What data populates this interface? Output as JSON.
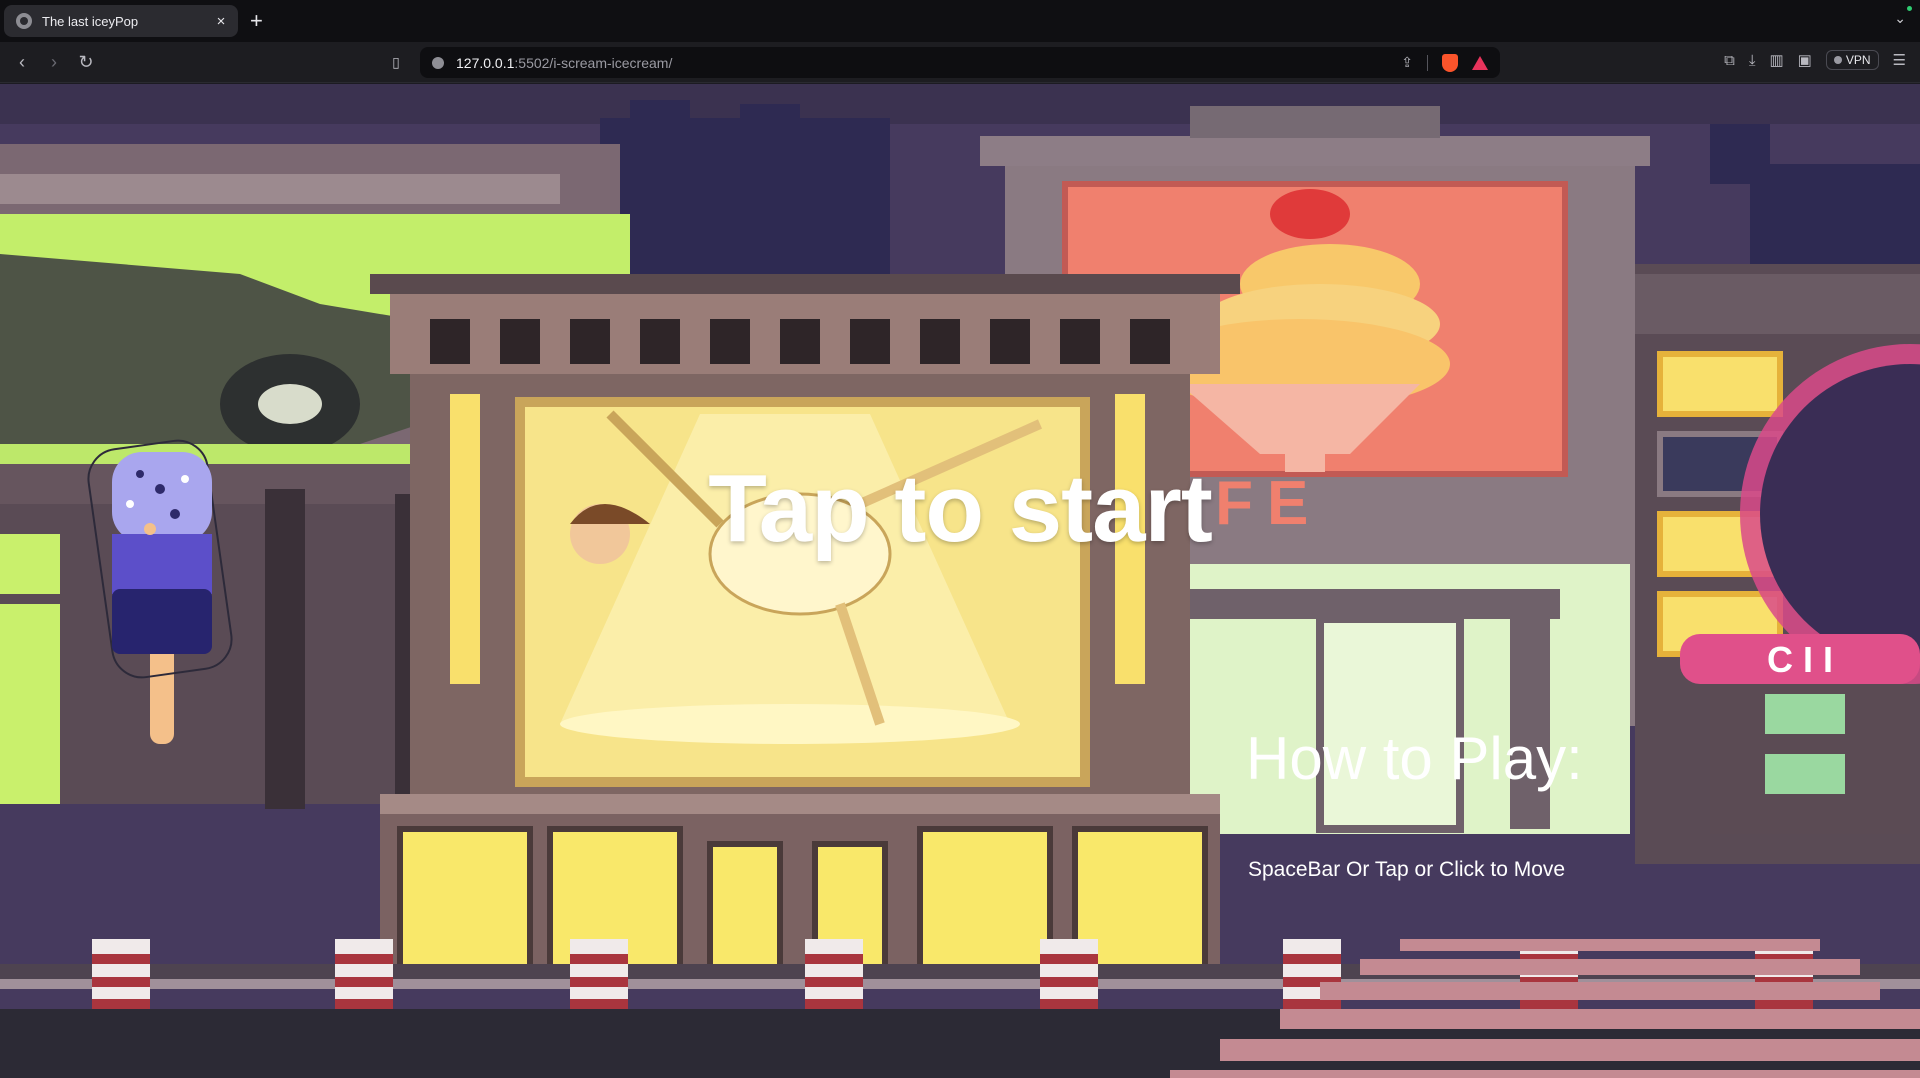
{
  "browser": {
    "tab_title": "The last iceyPop",
    "tab_close": "×",
    "new_tab": "+",
    "url_host": "127.0.0.1",
    "url_path": ":5502/i-scream-icecream/",
    "vpn_label": "VPN"
  },
  "game": {
    "start_prompt": "Tap to start",
    "howto_title": "How to Play:",
    "instructions": "SpaceBar Or Tap or Click to Move",
    "billboard_sign": "CAFE",
    "shop_sign": "C I I"
  },
  "colors": {
    "sky": "#463a5e",
    "road": "#2c2a35",
    "crosswalk": "#c48a92",
    "popsicle_top": "#a9a6ee",
    "popsicle_mid": "#5c4fc9",
    "popsicle_bottom": "#27246e",
    "stick": "#f4c08a"
  }
}
